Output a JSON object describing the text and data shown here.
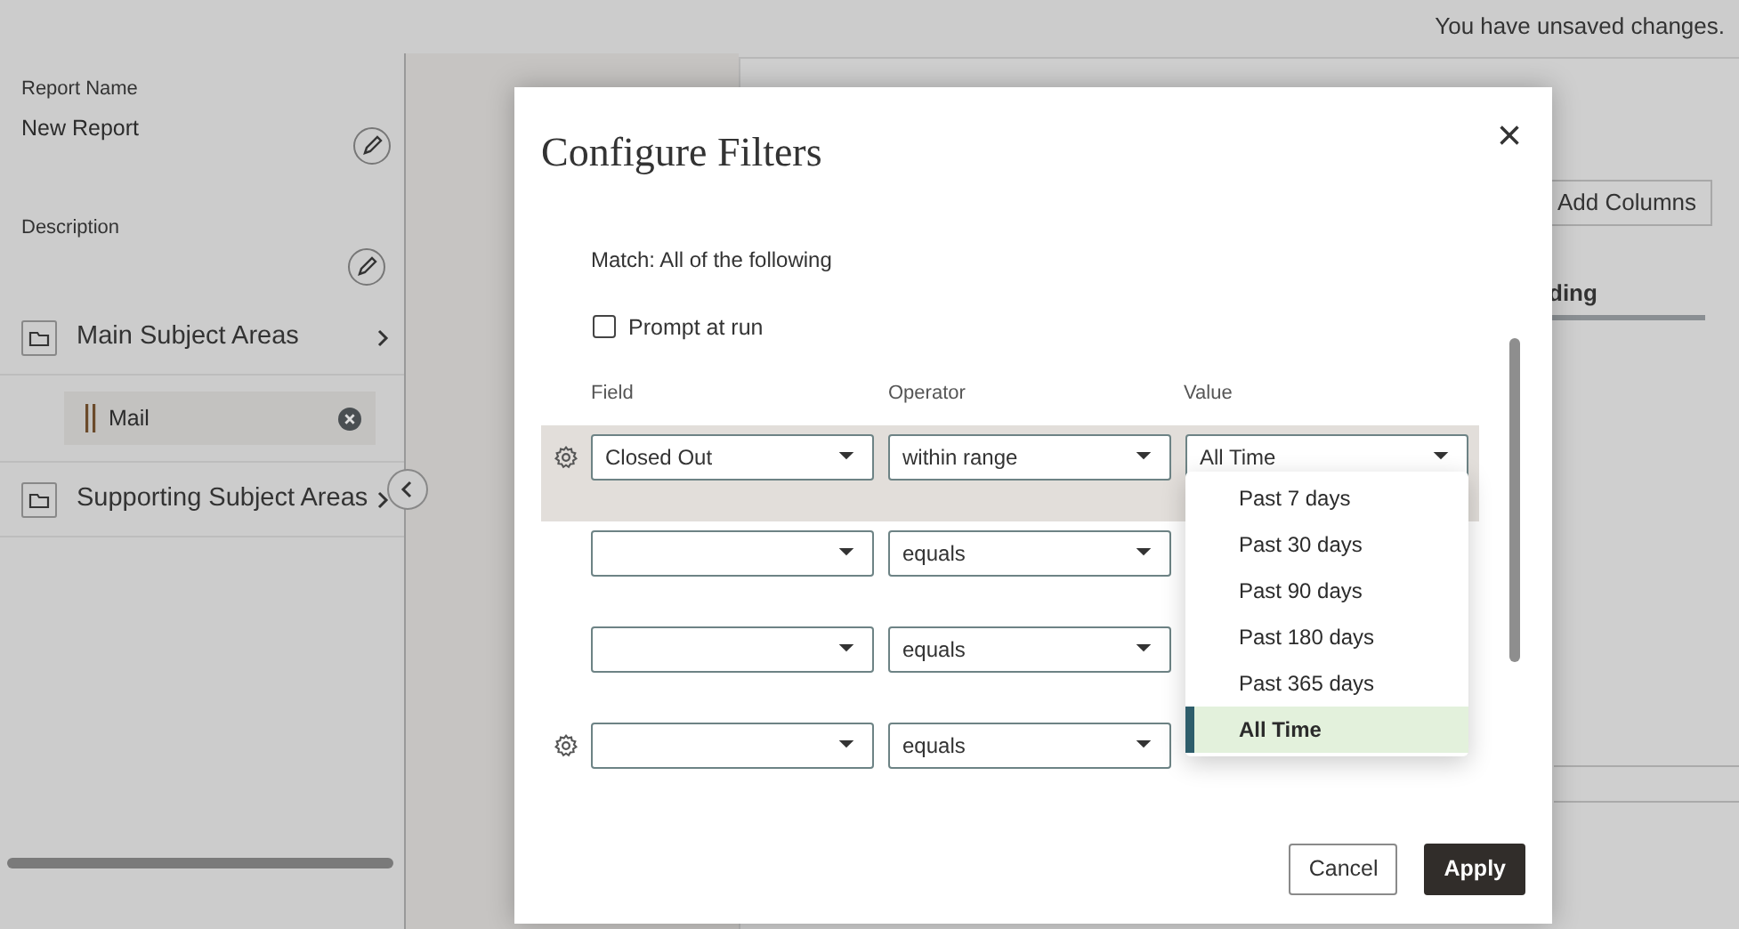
{
  "top_bar": {
    "message": "You have unsaved changes."
  },
  "sidebar": {
    "report_name": {
      "label": "Report Name",
      "value": "New Report"
    },
    "description": {
      "label": "Description"
    },
    "sections": [
      {
        "label": "Main Subject Areas",
        "items": [
          {
            "label": "Mail"
          }
        ]
      },
      {
        "label": "Supporting Subject Areas"
      }
    ]
  },
  "background": {
    "add_columns": "Add Columns",
    "column_heading": "ding"
  },
  "dialog": {
    "title": "Configure Filters",
    "close": "×",
    "match": "Match: All of the following",
    "prompt_at_run": {
      "label": "Prompt at run",
      "checked": false
    },
    "columns": [
      "Field",
      "Operator",
      "Value"
    ],
    "rows": [
      {
        "field": "Closed Out",
        "operator": "within range",
        "value": "All Time",
        "selected": true,
        "settings_icon": true
      },
      {
        "operator": "equals",
        "selected": false,
        "settings_icon": false
      },
      {
        "operator": "equals",
        "selected": false,
        "settings_icon": false
      },
      {
        "operator": "equals",
        "selected": false,
        "settings_icon": true
      }
    ],
    "value_options": [
      {
        "label": "Past 7 days",
        "selected": false
      },
      {
        "label": "Past 30 days",
        "selected": false
      },
      {
        "label": "Past 90 days",
        "selected": false
      },
      {
        "label": "Past 180 days",
        "selected": false
      },
      {
        "label": "Past 365 days",
        "selected": false
      },
      {
        "label": "All Time",
        "selected": true
      }
    ],
    "buttons": [
      {
        "label": "Cancel",
        "kind": "secondary"
      },
      {
        "label": "Apply",
        "kind": "primary"
      }
    ]
  }
}
